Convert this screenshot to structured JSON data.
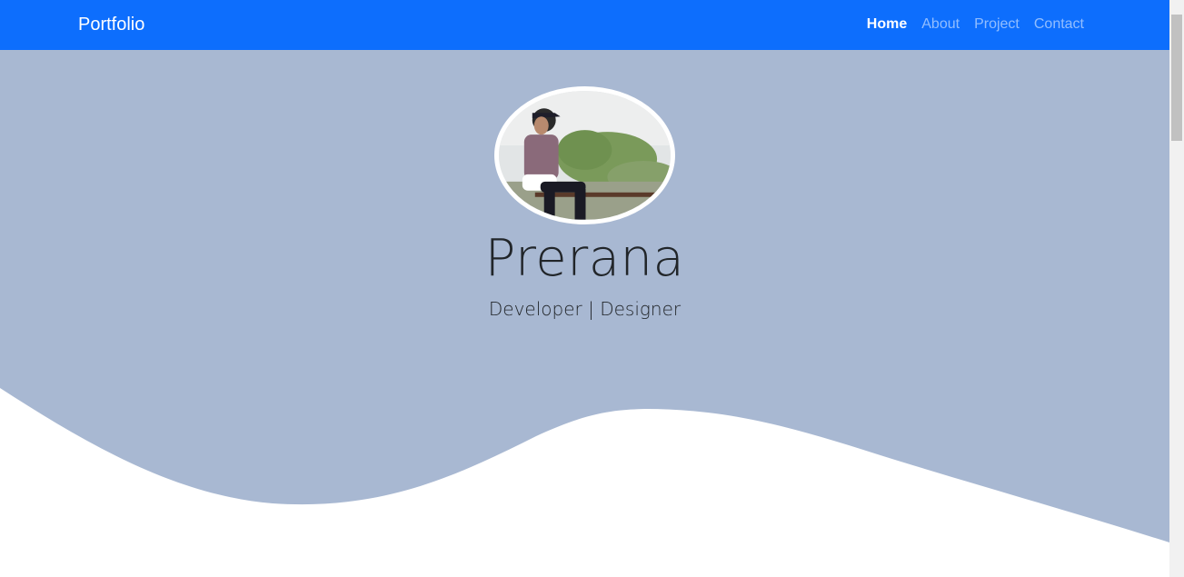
{
  "navbar": {
    "brand": "Portfolio",
    "links": [
      {
        "label": "Home",
        "active": true
      },
      {
        "label": "About",
        "active": false
      },
      {
        "label": "Project",
        "active": false
      },
      {
        "label": "Contact",
        "active": false
      }
    ]
  },
  "hero": {
    "name": "Prerana",
    "tagline": "Developer | Designer"
  },
  "colors": {
    "navbar_bg": "#0d6efd",
    "hero_bg": "#a8b8d2",
    "text": "#212529"
  }
}
